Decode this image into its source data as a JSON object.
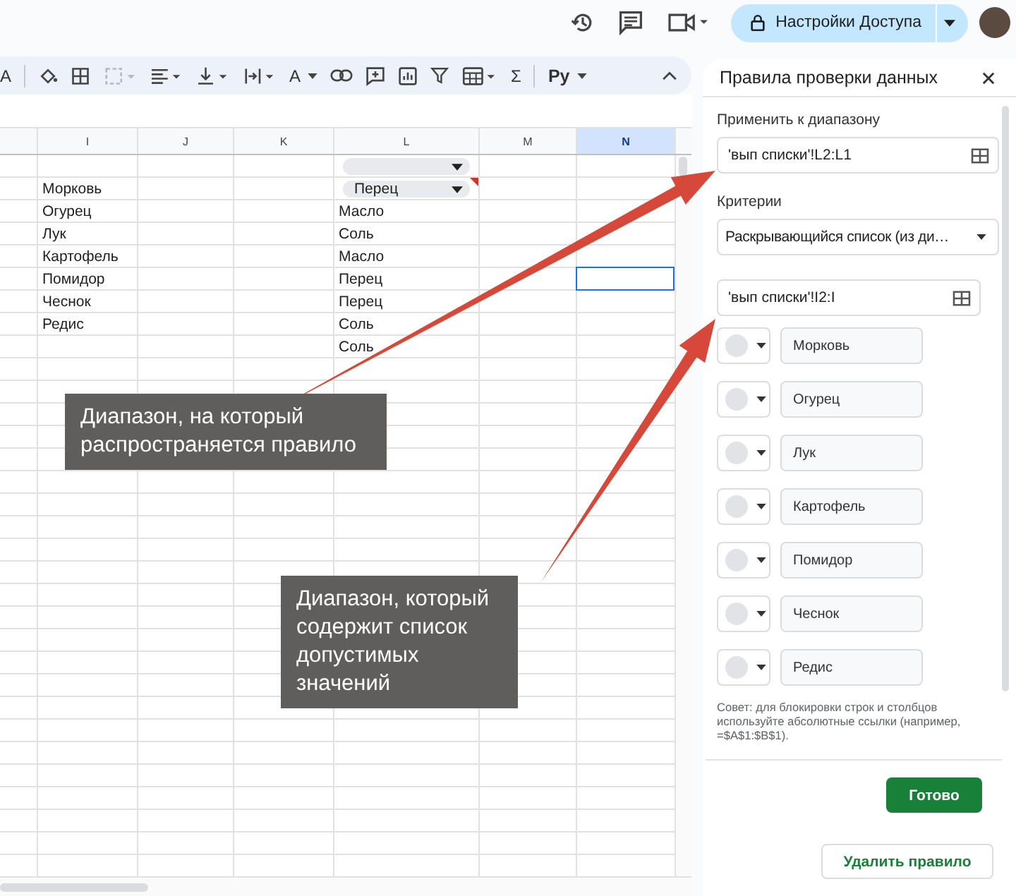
{
  "top_bar": {
    "share_button": "Настройки Доступа"
  },
  "toolbar": {
    "items": [
      {
        "kind": "glyph",
        "text": "A"
      },
      {
        "kind": "fill"
      },
      {
        "kind": "borders"
      },
      {
        "kind": "merge",
        "disabled": true
      },
      {
        "kind": "align"
      },
      {
        "kind": "valign"
      },
      {
        "kind": "wrap"
      },
      {
        "kind": "glyph",
        "text": "A",
        "caret": true
      },
      {
        "kind": "link"
      },
      {
        "kind": "comment"
      },
      {
        "kind": "chart"
      },
      {
        "kind": "filter"
      },
      {
        "kind": "table"
      },
      {
        "kind": "glyph",
        "text": "Σ"
      },
      {
        "kind": "glyph",
        "text": "Ру",
        "caret": true,
        "bold": true
      }
    ]
  },
  "sheet": {
    "columns": [
      {
        "label": "I",
        "selected": false
      },
      {
        "label": "J",
        "selected": false
      },
      {
        "label": "K",
        "selected": false
      },
      {
        "label": "L",
        "selected": false
      },
      {
        "label": "M",
        "selected": false
      },
      {
        "label": "N",
        "selected": true
      }
    ],
    "rows": [
      {
        "L": {
          "kind": "chip",
          "flagged": false
        },
        "n_selected": false
      },
      {
        "I": "Морковь",
        "L": {
          "kind": "chip",
          "text": "Перец",
          "flagged": true
        },
        "n_selected": false
      },
      {
        "I": "Огурец",
        "L": {
          "kind": "plain",
          "text": "Масло"
        },
        "n_selected": false
      },
      {
        "I": "Лук",
        "L": {
          "kind": "plain",
          "text": "Соль"
        },
        "n_selected": false
      },
      {
        "I": "Картофель",
        "L": {
          "kind": "plain",
          "text": "Масло"
        },
        "n_selected": false
      },
      {
        "I": "Помидор",
        "L": {
          "kind": "plain",
          "text": "Перец"
        },
        "n_selected": true
      },
      {
        "I": "Чеснок",
        "L": {
          "kind": "plain",
          "text": "Перец"
        },
        "n_selected": false
      },
      {
        "I": "Редис",
        "L": {
          "kind": "plain",
          "text": "Соль"
        },
        "n_selected": false
      },
      {
        "L": {
          "kind": "plain",
          "text": "Соль"
        },
        "n_selected": false
      }
    ]
  },
  "panel": {
    "title": "Правила проверки данных",
    "range_label": "Применить к диапазону",
    "range_value": "'вып списки'!L2:L1",
    "criteria_label": "Критерии",
    "criteria_value": "Раскрывающийся список (из ди…",
    "source_value": "'вып списки'!I2:I",
    "options": [
      "Морковь",
      "Огурец",
      "Лук",
      "Картофель",
      "Помидор",
      "Чеснок",
      "Редис"
    ],
    "hint": "Совет: для блокировки строк и столбцов используйте абсолютные ссылки (например, =$A$1:$B$1).",
    "done_button": "Готово",
    "delete_button": "Удалить правило"
  },
  "callouts": [
    "Диапазон, на который распространяется правило",
    "Диапазон, который содержит список допустимых значений"
  ]
}
